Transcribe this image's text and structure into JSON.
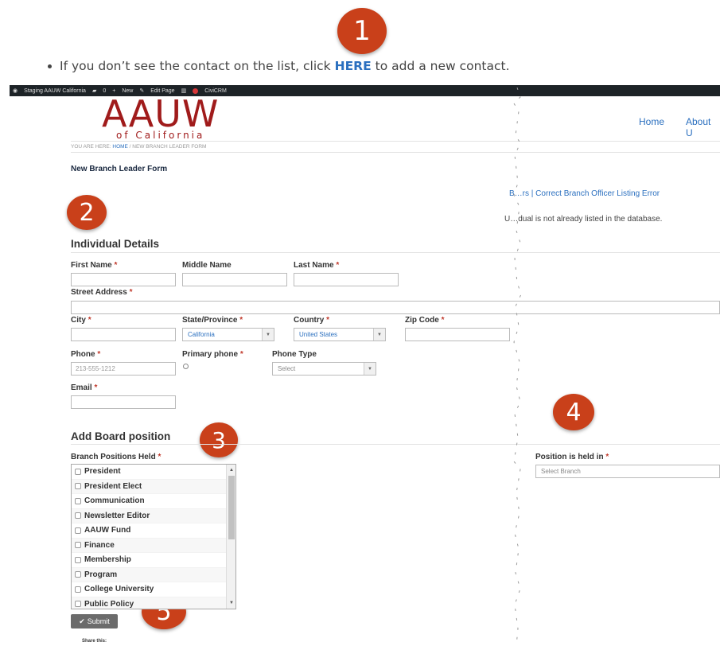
{
  "annotations": [
    "1",
    "2",
    "3",
    "4",
    "5"
  ],
  "top_note": {
    "prefix": "If you don’t see the contact on the list, click ",
    "link": "HERE",
    "suffix": " to add a new contact."
  },
  "admin_bar": {
    "site": "Staging AAUW California",
    "comments": "0",
    "new": "New",
    "edit_page": "Edit Page",
    "civicrm": "CiviCRM"
  },
  "logo": {
    "main": "AAUW",
    "sub": "of California"
  },
  "nav": {
    "home": "Home",
    "about": "About U"
  },
  "breadcrumb": {
    "prefix": "YOU ARE HERE: ",
    "home": "HOME",
    "current": " / NEW BRANCH LEADER FORM"
  },
  "page_title": "New Branch Leader Form",
  "right_links": "B…rs | Correct Branch Officer Listing Error",
  "right_text": "U…dual is not already listed in the database.",
  "individual": {
    "title": "Individual Details",
    "first_name": "First Name",
    "middle_name": "Middle Name",
    "last_name": "Last Name",
    "street": "Street Address",
    "city": "City",
    "state": "State/Province",
    "state_value": "California",
    "country": "Country",
    "country_value": "United States",
    "zip": "Zip Code",
    "phone": "Phone",
    "phone_placeholder": "213-555-1212",
    "primary_phone": "Primary phone",
    "phone_type": "Phone Type",
    "phone_type_value": "Select",
    "email": "Email",
    "required_mark": "*"
  },
  "board": {
    "title": "Add Board position",
    "positions_label": "Branch Positions Held",
    "positions": [
      "President",
      "President Elect",
      "Communication",
      "Newsletter Editor",
      "AAUW Fund",
      "Finance",
      "Membership",
      "Program",
      "College University",
      "Public Policy"
    ],
    "held_in_label": "Position is held in",
    "held_in_value": "Select Branch"
  },
  "submit_label": "Submit",
  "share_this": "Share this:",
  "colors": {
    "brand_red": "#a01b1b",
    "link_blue": "#2a6fbf",
    "badge": "#c9401a",
    "admin_bar": "#1d2327"
  }
}
